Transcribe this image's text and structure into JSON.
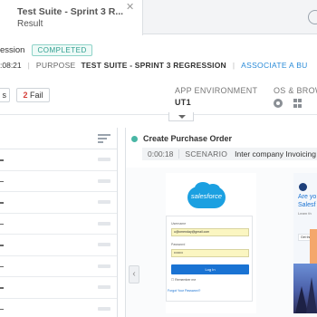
{
  "tabs": {
    "active_title": "Test Suite - Sprint 3 R...",
    "active_subtitle": "Result",
    "close_icon": "close-icon"
  },
  "header": {
    "session_label": "ession",
    "status_badge": "COMPLETED",
    "time": ":08:21",
    "purpose_label": "PURPOSE",
    "purpose_value": "TEST SUITE - SPRINT 3 REGRESSION",
    "associate_link": "ASSOCIATE A BU"
  },
  "filters": {
    "partial_button": "s",
    "fail_count": "2",
    "fail_label": "Fail"
  },
  "environment": {
    "app_env_label": "APP ENVIRONMENT",
    "app_env_value": "UT1",
    "os_label": "OS & BROW"
  },
  "left_list": {
    "rows": 8
  },
  "step": {
    "title": "Create Purchase Order",
    "duration": "0:00:18",
    "scenario_label": "SCENARIO",
    "scenario_name": "Inter company Invoicing"
  },
  "screenshot": {
    "logo_text": "salesforce",
    "username_label": "Username",
    "username_value": "u@cmenday@gmail.com",
    "password_label": "Password",
    "password_value": "••••••••",
    "login_button": "Log In",
    "remember_label": "Remember me",
    "forgot_link": "Forgot Your Password?",
    "side_heading_1": "Are yo",
    "side_heading_2": "Salesf",
    "side_text": "Learn th",
    "side_cta": "Get the"
  }
}
